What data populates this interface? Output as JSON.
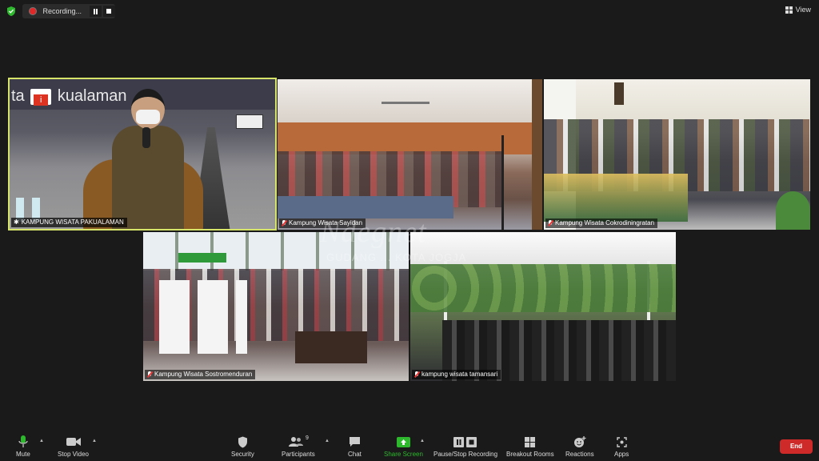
{
  "topbar": {
    "recording_label": "Recording...",
    "view_label": "View",
    "colors": {
      "security_shield": "#2eb82e",
      "rec_dot": "#e02828"
    }
  },
  "tiles": [
    {
      "name": "KAMPUNG WISATA PAKUALAMAN",
      "active": true,
      "muted": false
    },
    {
      "name": "Kampung Wisata Sayidan",
      "active": false,
      "muted": true
    },
    {
      "name": "Kampung Wisata Cokrodiningratan",
      "active": false,
      "muted": true
    },
    {
      "name": "Kampung Wisata Sostromenduran",
      "active": false,
      "muted": true
    },
    {
      "name": "kampung wisata tamansari",
      "active": false,
      "muted": true
    }
  ],
  "video_text": {
    "banner": "ta",
    "banner_rest": "kualaman",
    "logo_text": "i"
  },
  "watermark": {
    "title": "Ndegnet",
    "subtitle": "GUDANG ... KOTA JOGJA"
  },
  "toolbar": {
    "mute": "Mute",
    "stop_video": "Stop Video",
    "security": "Security",
    "participants": "Participants",
    "participants_count": "9",
    "chat": "Chat",
    "share_screen": "Share Screen",
    "pause_stop_recording": "Pause/Stop Recording",
    "breakout_rooms": "Breakout Rooms",
    "reactions": "Reactions",
    "apps": "Apps",
    "end": "End",
    "colors": {
      "share_green": "#2eb82e",
      "end_red": "#cf2a2a"
    }
  }
}
